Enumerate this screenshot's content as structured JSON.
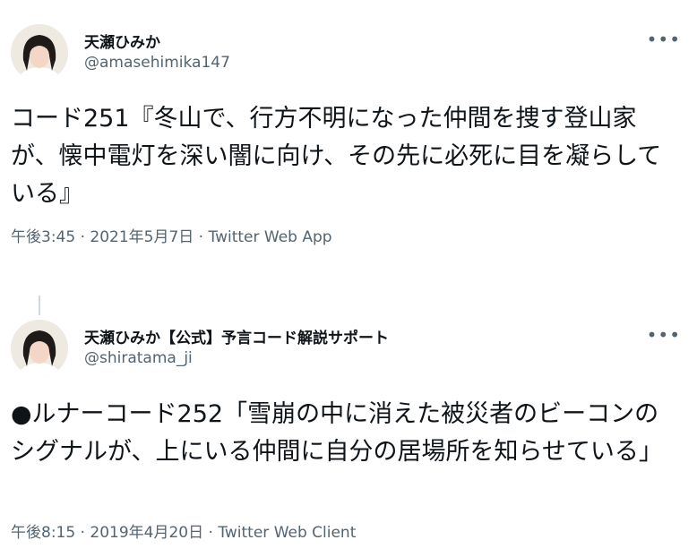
{
  "tweets": [
    {
      "display_name": "天瀬ひみか",
      "handle": "@amasehimika147",
      "text": "コード251『冬山で、行方不明になった仲間を捜す登山家が、懐中電灯を深い闇に向け、その先に必死に目を凝らしている』",
      "time": "午後3:45 · 2021年5月7日 · ",
      "source": "Twitter Web App",
      "more_icon": "more-horizontal-icon"
    },
    {
      "display_name": "天瀬ひみか【公式】予言コード解説サポート",
      "handle": "@shiratama_ji",
      "text": "●ルナーコード252「雪崩の中に消えた被災者のビーコンのシグナルが、上にいる仲間に自分の居場所を知らせている」",
      "time": "午後8:15 · 2019年4月20日 · ",
      "source": "Twitter Web Client",
      "more_icon": "more-horizontal-icon"
    }
  ]
}
